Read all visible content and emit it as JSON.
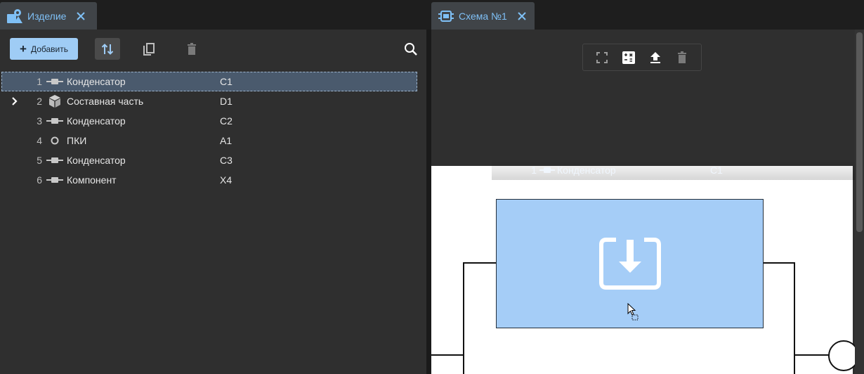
{
  "tabs": [
    {
      "label": "Изделие",
      "icon": "product-structure-icon"
    },
    {
      "label": "Схема №1",
      "icon": "scheme-icon"
    }
  ],
  "toolbar": {
    "add_label": "Добавить"
  },
  "tree": {
    "rows": [
      {
        "num": "1",
        "name": "Конденсатор",
        "code": "C1",
        "icon": "capacitor-icon",
        "selected": true,
        "expandable": false
      },
      {
        "num": "2",
        "name": "Составная часть",
        "code": "D1",
        "icon": "cube-icon",
        "selected": false,
        "expandable": true
      },
      {
        "num": "3",
        "name": "Конденсатор",
        "code": "C2",
        "icon": "capacitor-icon",
        "selected": false,
        "expandable": false
      },
      {
        "num": "4",
        "name": "ПКИ",
        "code": "A1",
        "icon": "circle-icon",
        "selected": false,
        "expandable": false
      },
      {
        "num": "5",
        "name": "Конденсатор",
        "code": "C3",
        "icon": "capacitor-icon",
        "selected": false,
        "expandable": false
      },
      {
        "num": "6",
        "name": "Компонент",
        "code": "X4",
        "icon": "capacitor-icon",
        "selected": false,
        "expandable": false
      }
    ]
  },
  "drag": {
    "num": "1",
    "name": "Конденсатор",
    "code": "C1"
  },
  "colors": {
    "accent": "#7fc0f6",
    "add_button": "#9fccf5",
    "selection": "#4a5a6d",
    "drop_zone": "#a5cdf7",
    "panel_bg": "#2f2f2f"
  }
}
